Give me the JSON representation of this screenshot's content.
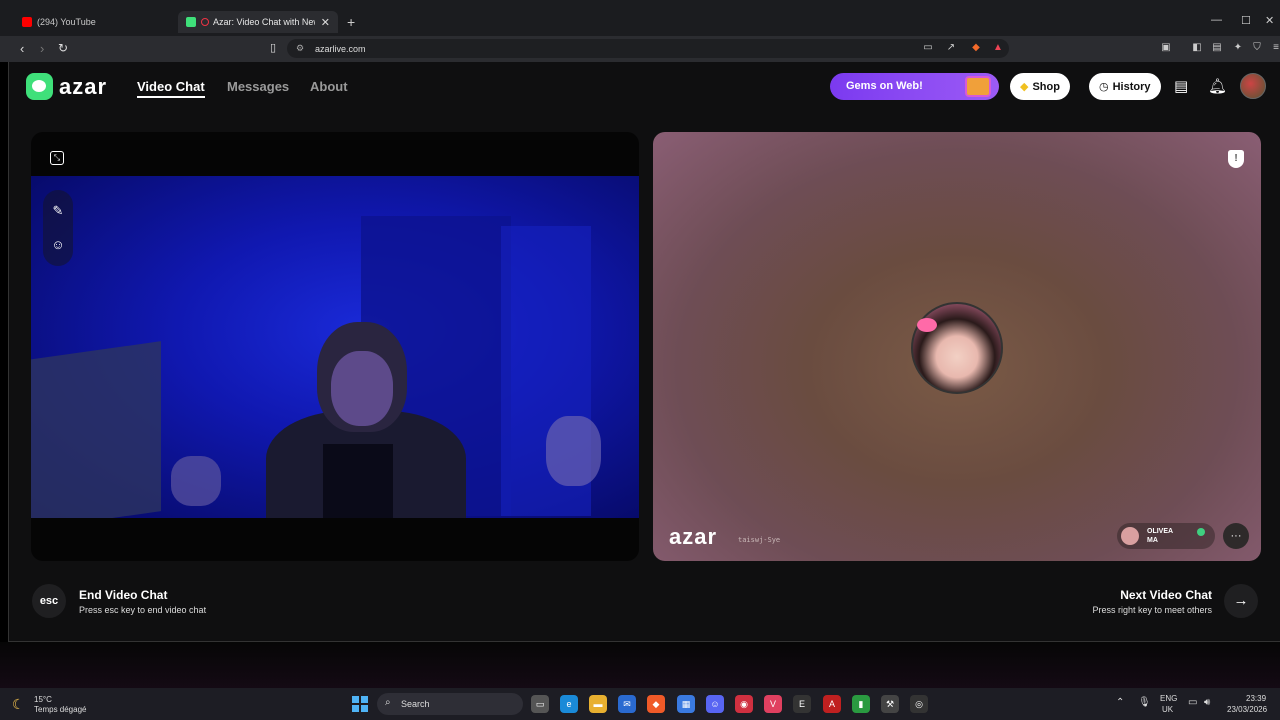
{
  "browser": {
    "tabs": [
      {
        "title": "(294) YouTube",
        "favicon_color": "#ff0000"
      },
      {
        "title": "Azar: Video Chat with New Pe",
        "favicon_color": "#3fe07a"
      }
    ],
    "url": "azarlive.com"
  },
  "header": {
    "logo_text": "azar",
    "nav": [
      {
        "label": "Video Chat",
        "active": true
      },
      {
        "label": "Messages",
        "active": false
      },
      {
        "label": "About",
        "active": false
      }
    ],
    "gems_label": "Gems on Web!",
    "shop_label": "Shop",
    "history_label": "History"
  },
  "remote": {
    "watermark": "azar",
    "user_id": "taiswj-Sye",
    "name_line1": "OLIVEA",
    "name_line2": "MA"
  },
  "controls": {
    "esc_key": "esc",
    "end_title": "End Video Chat",
    "end_sub": "Press esc key to end video chat",
    "next_title": "Next Video Chat",
    "next_sub": "Press right key to meet others"
  },
  "taskbar": {
    "temperature": "15°C",
    "condition": "Temps dégagé",
    "search_label": "Search",
    "lang_line1": "ENG",
    "lang_line2": "UK",
    "time": "23:39",
    "date": "23/03/2026"
  },
  "colors": {
    "brand_green": "#3fe07a",
    "gems_purple": "#8a4af2"
  }
}
